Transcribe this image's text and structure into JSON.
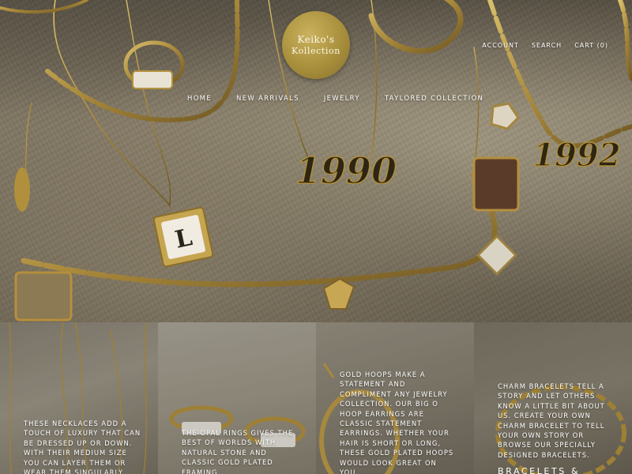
{
  "brand": {
    "line1": "Keiko's",
    "line2": "Kollection"
  },
  "utility_nav": {
    "account": "ACCOUNT",
    "search": "SEARCH",
    "cart": "CART (0)"
  },
  "main_nav": [
    "HOME",
    "NEW ARRIVALS",
    "JEWELRY",
    "TAYLORED COLLECTION"
  ],
  "hero": {
    "pendant_1": "1990",
    "pendant_2": "1992",
    "letter_charm": "L"
  },
  "tiles": [
    {
      "caption": "These necklaces add a touch of luxury that can be dressed up or down. With their medium size you can layer them or wear them singularly."
    },
    {
      "caption": "The opal rings gives the best of worlds with natural stone and classic gold plated framing."
    },
    {
      "caption": "Gold hoops make a statement and compliment any jewelry collection. Our big O hoop earrings are classic statement earrings. Whether your hair is short or long, these gold plated hoops would look great on you."
    },
    {
      "caption": "Charm bracelets tell a story and let others know a little bit about us. Create your own charm bracelet to tell your own story or browse our specially designed bracelets.",
      "title": "BRACELETS &"
    }
  ],
  "colors": {
    "gold": "#b89a43",
    "logo_gold": "#a88f3c",
    "fabric": "#857b67"
  }
}
